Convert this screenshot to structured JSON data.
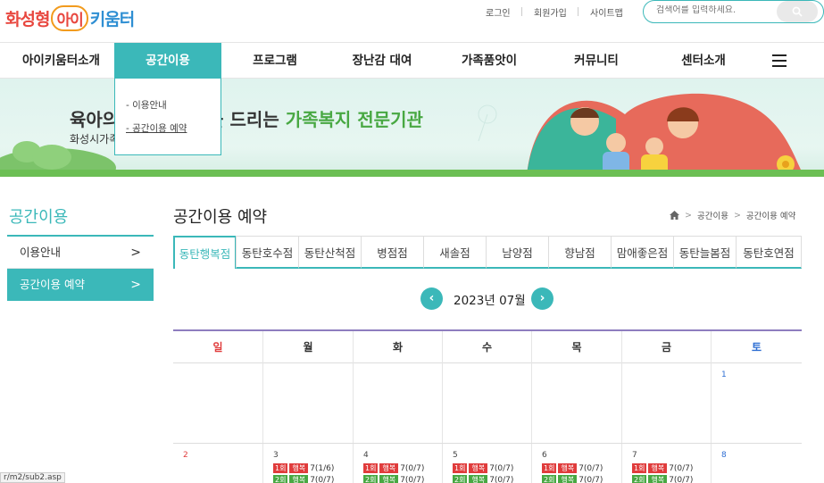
{
  "header": {
    "logo": {
      "p1": "화성형",
      "p2": "아이",
      "p3": "키움터"
    },
    "util": {
      "login": "로그인",
      "signup": "회원가입",
      "sitemap": "사이트맵"
    },
    "search_placeholder": "검색어를 입력하세요."
  },
  "nav": {
    "items": [
      "아이키움터소개",
      "공간이용",
      "프로그램",
      "장난감 대여",
      "가족품앗이",
      "커뮤니티",
      "센터소개"
    ],
    "active_index": 1
  },
  "dropdown": {
    "items": [
      "- 이용안내",
      "- 공간이용 예약"
    ]
  },
  "banner": {
    "title_a": "육아의 ",
    "title_b": "을 드리는 ",
    "title_hl": "가족복지 전문기관",
    "subtitle": "화성시가족"
  },
  "side": {
    "title": "공간이용",
    "items": [
      {
        "label": "이용안내",
        "arrow": ">"
      },
      {
        "label": "공간이용 예약",
        "arrow": ">"
      }
    ],
    "active_index": 1
  },
  "content": {
    "title": "공간이용 예약",
    "breadcrumb": [
      "공간이용",
      "공간이용 예약"
    ],
    "bc_sep": ">",
    "tabs": [
      "동탄행복점",
      "동탄호수점",
      "동탄산척점",
      "병점점",
      "새솔점",
      "남양점",
      "향남점",
      "맘애좋은점",
      "동탄늘봄점",
      "동탄호연점"
    ],
    "active_tab": 0,
    "month": "2023년 07월",
    "prev": "‹",
    "next": "›"
  },
  "calendar": {
    "weekdays": [
      "일",
      "월",
      "화",
      "수",
      "목",
      "금",
      "토"
    ],
    "week1": [
      "",
      "",
      "",
      "",
      "",
      "",
      "1"
    ],
    "week2": [
      "2",
      "3",
      "4",
      "5",
      "6",
      "7",
      "8"
    ],
    "slot1": {
      "num": "1회",
      "name": "행복"
    },
    "slot2": {
      "num": "2회",
      "name": "행복"
    },
    "week2_slot1": [
      "",
      "7(1/6)",
      "7(0/7)",
      "7(0/7)",
      "7(0/7)",
      "7(0/7)",
      ""
    ],
    "week2_slot2": [
      "",
      "7(0/7)",
      "7(0/7)",
      "7(0/7)",
      "7(0/7)",
      "7(0/7)",
      ""
    ]
  },
  "status_url": "r/m2/sub2.asp",
  "colors": {
    "teal": "#3bb8b9",
    "green": "#48a842",
    "red": "#e03c3c",
    "blue": "#2f6fd3",
    "purple": "#8e7dbf"
  }
}
